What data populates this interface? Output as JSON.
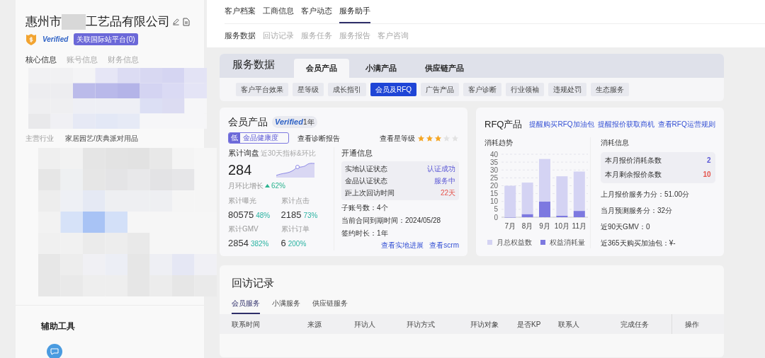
{
  "company": {
    "name_start": "惠州市",
    "name_end": "工艺品有限公司",
    "verified": "Verified",
    "badge": "关联国际站平台(0)"
  },
  "left_tabs": [
    {
      "label": "核心信息",
      "selected": true
    },
    {
      "label": "账号信息",
      "selected": false
    },
    {
      "label": "财务信息",
      "selected": false
    }
  ],
  "industry": {
    "label": "主营行业",
    "value": "家居园艺/庆典派对用品"
  },
  "tools": {
    "title": "辅助工具"
  },
  "top_tabs": [
    {
      "label": "客户档案",
      "selected": false
    },
    {
      "label": "工商信息",
      "selected": false
    },
    {
      "label": "客户动态",
      "selected": false
    },
    {
      "label": "服务助手",
      "selected": true
    }
  ],
  "sub_tabs": [
    {
      "label": "服务数据",
      "selected": true
    },
    {
      "label": "回访记录",
      "selected": false
    },
    {
      "label": "服务任务",
      "selected": false
    },
    {
      "label": "服务报告",
      "selected": false
    },
    {
      "label": "客户咨询",
      "selected": false
    }
  ],
  "service_data": {
    "title": "服务数据",
    "product_tabs": [
      {
        "label": "会员产品",
        "selected": true
      },
      {
        "label": "小满产品",
        "selected": false
      },
      {
        "label": "供应链产品",
        "selected": false
      }
    ],
    "filters": [
      {
        "label": "客户平台效果",
        "selected": false
      },
      {
        "label": "星等级",
        "selected": false
      },
      {
        "label": "成长指引",
        "selected": false
      },
      {
        "label": "会员及RFQ",
        "selected": true
      },
      {
        "label": "广告产品",
        "selected": false
      },
      {
        "label": "客户诊断",
        "selected": false
      },
      {
        "label": "行业领袖",
        "selected": false
      },
      {
        "label": "违规处罚",
        "selected": false
      },
      {
        "label": "生态服务",
        "selected": false
      }
    ]
  },
  "member": {
    "title": "会员产品",
    "verified": "Verified",
    "years": "1年",
    "health": {
      "level": "低",
      "label": "金品健康度"
    },
    "diagnosis_link": "查看诊断报告",
    "star_link": "查看星等级",
    "stars": 3,
    "inquiry": {
      "title": "累计询盘",
      "subtitle": "近30天指标&环比",
      "value": "284",
      "growth_label": "月环比增长",
      "growth": "62%"
    },
    "metrics": [
      {
        "label": "累计曝光",
        "value": "80575",
        "change": "48%"
      },
      {
        "label": "累计点击",
        "value": "2185",
        "change": "73%"
      },
      {
        "label": "累计GMV",
        "value": "2854",
        "change": "382%"
      },
      {
        "label": "累计订单",
        "value": "6",
        "change": "200%"
      }
    ],
    "open_info": {
      "title": "开通信息",
      "rows": [
        {
          "label": "实地认证状态",
          "value": "认证成功",
          "kind": "normal"
        },
        {
          "label": "金品认证状态",
          "value": "服务中",
          "kind": "normal"
        },
        {
          "label": "距上次回访时间",
          "value": "22天",
          "kind": "warn"
        }
      ],
      "lines": [
        "子账号数：4个",
        "当前合同到期时间：2024/05/28",
        "签约时长：1年"
      ],
      "links": [
        "查看实地进展",
        "查看scrm"
      ]
    }
  },
  "rfq": {
    "title": "RFQ产品",
    "links": [
      "提醒购买RFQ加油包",
      "提醒报价获取商机",
      "查看RFQ运营规则"
    ],
    "trend_title": "消耗趋势",
    "chart_data": {
      "type": "bar",
      "categories": [
        "7月",
        "8月",
        "9月",
        "10月",
        "11月"
      ],
      "ylim": [
        0,
        40
      ],
      "yticks": [
        0,
        5,
        10,
        15,
        20,
        25,
        30,
        35,
        40
      ],
      "stacked": true,
      "grid": true,
      "legend": true,
      "series": [
        {
          "name": "月总权益数",
          "color": "#d4d3f3",
          "values": [
            20,
            20,
            27,
            25,
            25
          ]
        },
        {
          "name": "权益消耗量",
          "color": "#7d79e0",
          "values": [
            0,
            2,
            10,
            1,
            4
          ]
        }
      ]
    },
    "info_title": "消耗信息",
    "rows": [
      {
        "label": "本月报价消耗条数",
        "value": "2",
        "kind": "normal"
      },
      {
        "label": "本月剩余报价条数",
        "value": "10",
        "kind": "warn"
      }
    ],
    "lines": [
      "上月报价服务力分：51.00分",
      "当月预测服务分：32分",
      "近90天GMV：0",
      "近365天购买加油包：¥-"
    ]
  },
  "visits": {
    "title": "回访记录",
    "tabs": [
      {
        "label": "会员服务",
        "selected": true
      },
      {
        "label": "小满服务",
        "selected": false
      },
      {
        "label": "供应链服务",
        "selected": false
      }
    ],
    "columns": [
      "联系时间",
      "来源",
      "拜访人",
      "拜访方式",
      "拜访对象",
      "是否KP",
      "联系人",
      "完成任务",
      "操作"
    ]
  }
}
